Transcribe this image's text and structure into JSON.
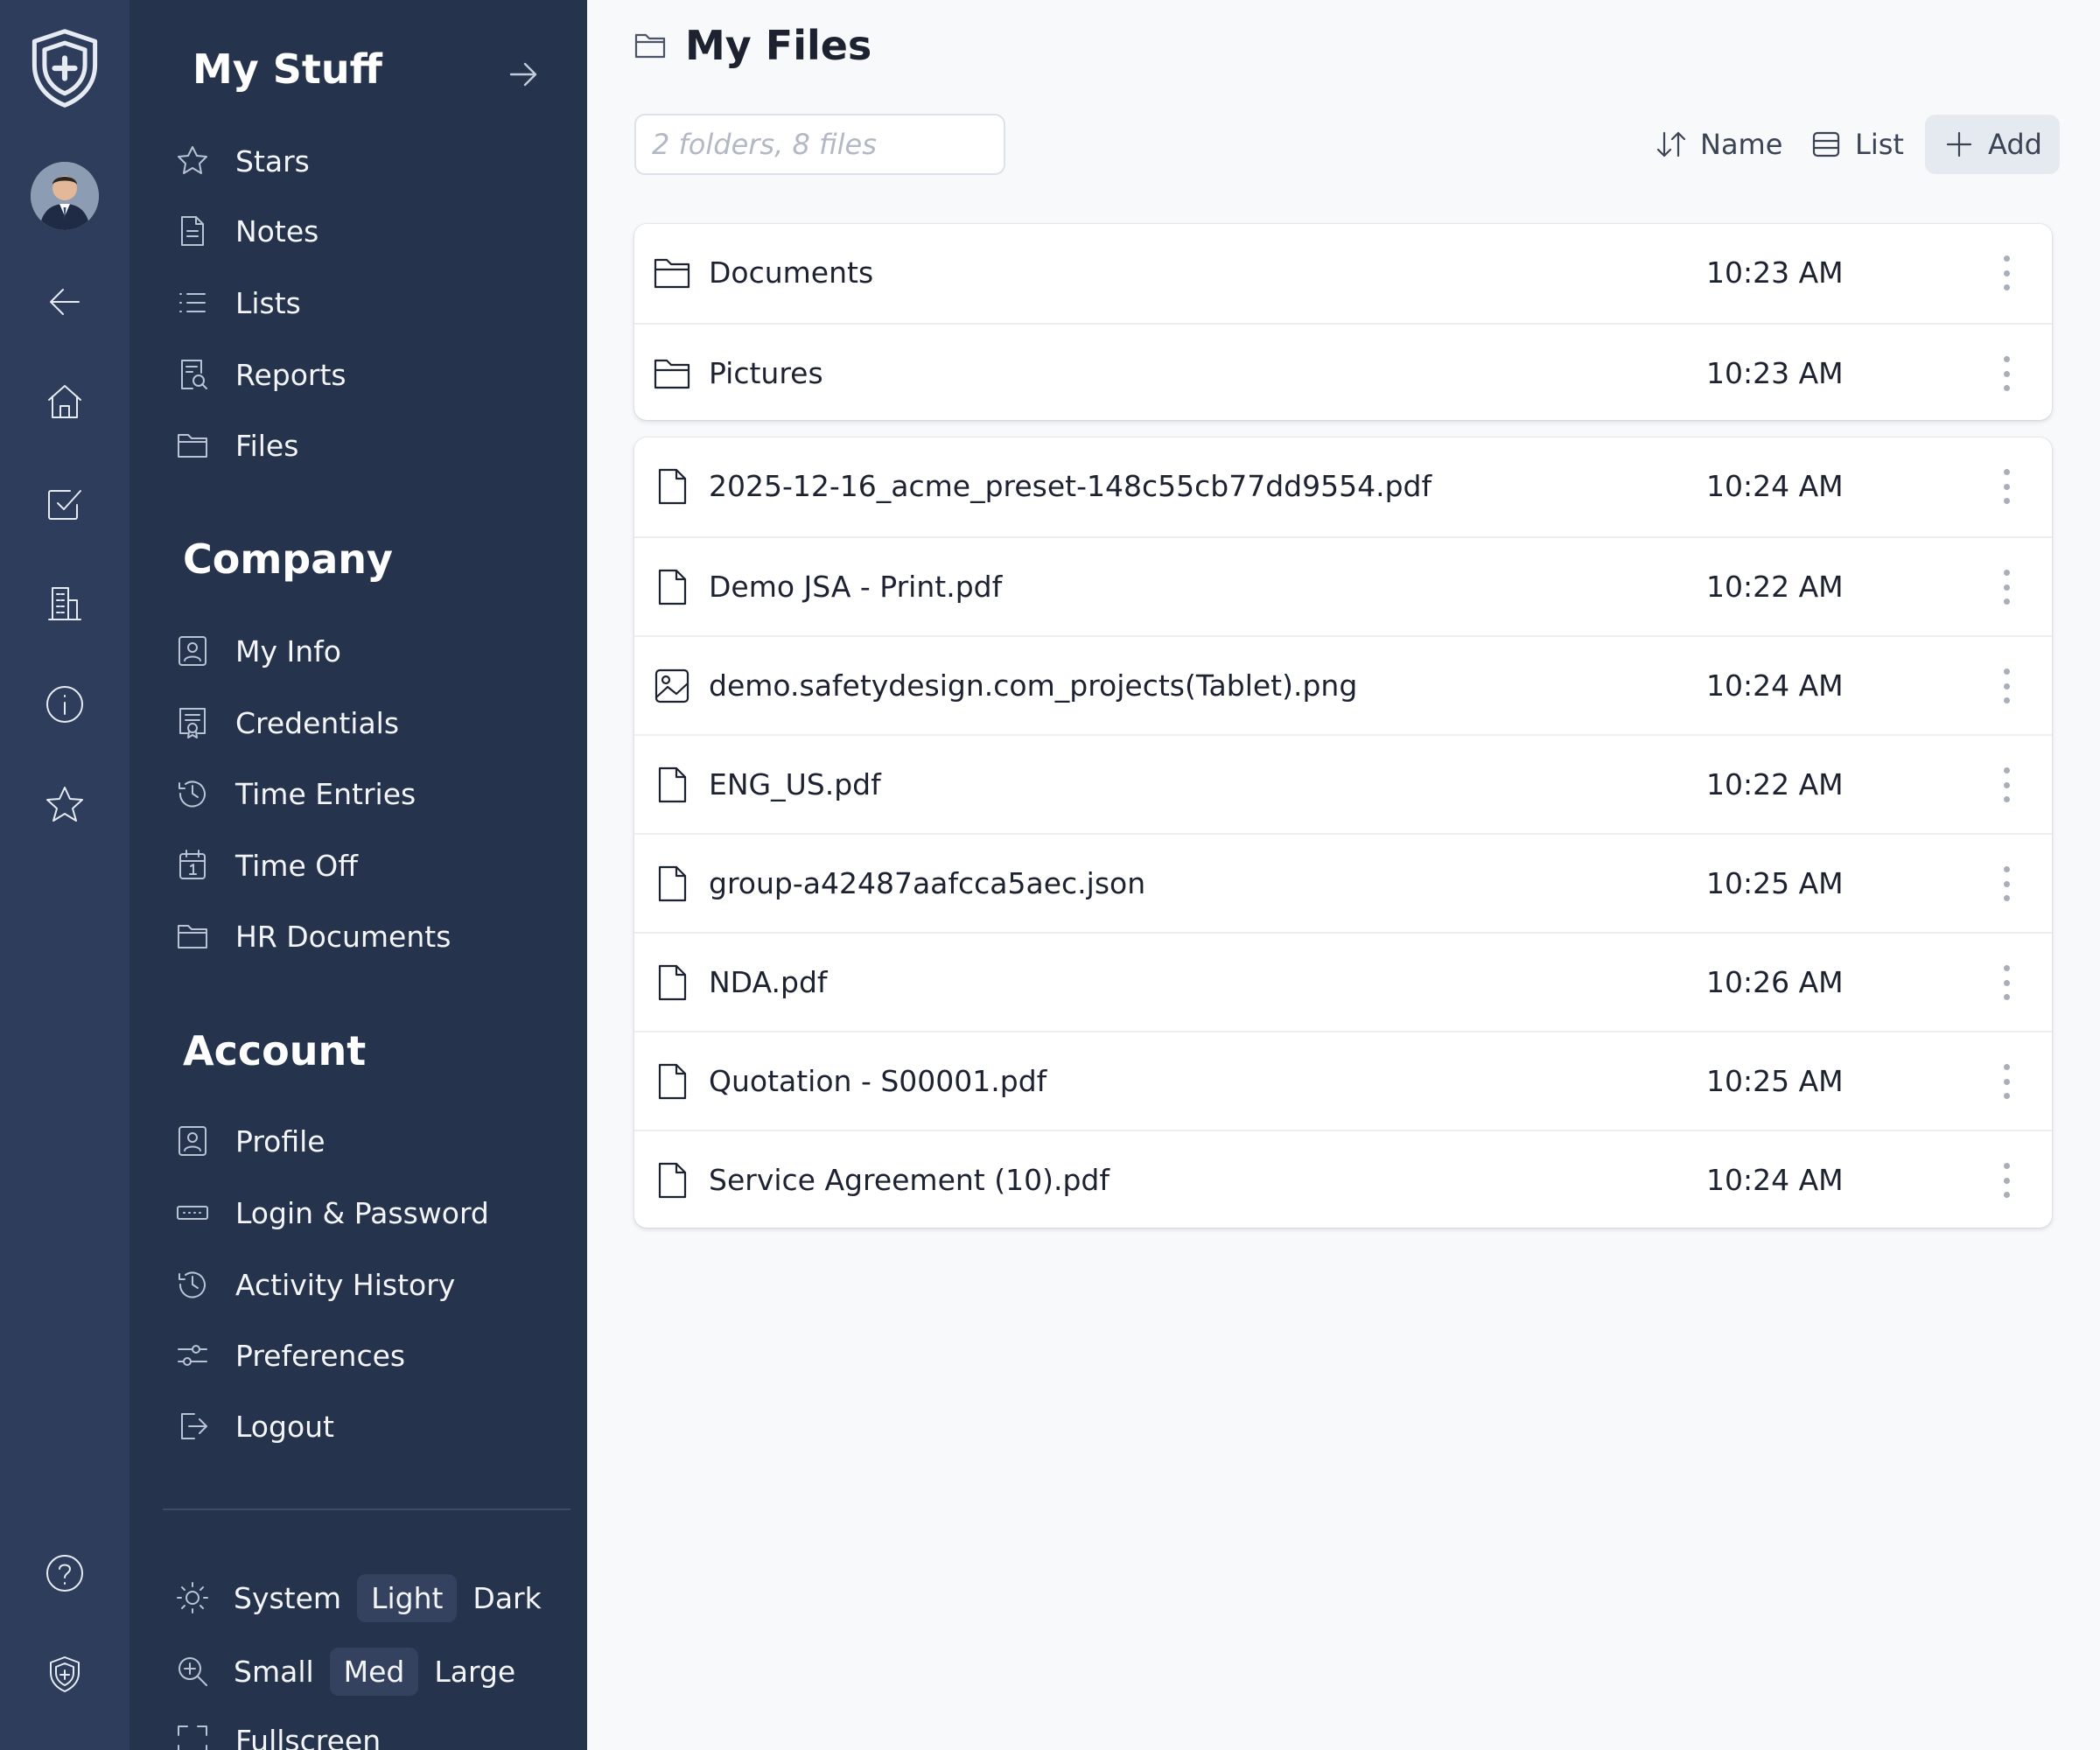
{
  "rail": {
    "items": [
      {
        "icon": "shield-logo-icon"
      },
      {
        "icon": "avatar"
      },
      {
        "icon": "arrow-left-icon"
      },
      {
        "icon": "home-icon"
      },
      {
        "icon": "checkbox-icon"
      },
      {
        "icon": "building-icon"
      },
      {
        "icon": "info-icon"
      },
      {
        "icon": "star-icon"
      },
      {
        "icon": "help-icon"
      },
      {
        "icon": "shield-small-icon"
      }
    ]
  },
  "sidebar": {
    "title": "My Stuff",
    "my_stuff": [
      {
        "label": "Stars",
        "icon": "star-icon"
      },
      {
        "label": "Notes",
        "icon": "note-icon"
      },
      {
        "label": "Lists",
        "icon": "list-icon"
      },
      {
        "label": "Reports",
        "icon": "report-icon"
      },
      {
        "label": "Files",
        "icon": "folder-icon"
      }
    ],
    "company_title": "Company",
    "company": [
      {
        "label": "My Info",
        "icon": "id-card-icon"
      },
      {
        "label": "Credentials",
        "icon": "certificate-icon"
      },
      {
        "label": "Time Entries",
        "icon": "clock-icon"
      },
      {
        "label": "Time Off",
        "icon": "calendar-icon"
      },
      {
        "label": "HR Documents",
        "icon": "folder-icon"
      }
    ],
    "account_title": "Account",
    "account": [
      {
        "label": "Profile",
        "icon": "id-card-icon"
      },
      {
        "label": "Login & Password",
        "icon": "password-icon"
      },
      {
        "label": "Activity History",
        "icon": "history-icon"
      },
      {
        "label": "Preferences",
        "icon": "sliders-icon"
      },
      {
        "label": "Logout",
        "icon": "logout-icon"
      }
    ],
    "theme": {
      "options": [
        "System",
        "Light",
        "Dark"
      ],
      "selected": "Light"
    },
    "size": {
      "options": [
        "Small",
        "Med",
        "Large"
      ],
      "selected": "Med"
    },
    "fullscreen_label": "Fullscreen"
  },
  "main": {
    "title": "My Files",
    "search_placeholder": "2 folders, 8 files",
    "sort_label": "Name",
    "view_label": "List",
    "add_label": "Add",
    "folders": [
      {
        "name": "Documents",
        "time": "10:23 AM",
        "icon": "folder-icon"
      },
      {
        "name": "Pictures",
        "time": "10:23 AM",
        "icon": "folder-icon"
      }
    ],
    "files": [
      {
        "name": "2025-12-16_acme_preset-148c55cb77dd9554.pdf",
        "time": "10:24 AM",
        "icon": "file-icon"
      },
      {
        "name": "Demo JSA - Print.pdf",
        "time": "10:22 AM",
        "icon": "file-icon"
      },
      {
        "name": "demo.safetydesign.com_projects(Tablet).png",
        "time": "10:24 AM",
        "icon": "image-icon"
      },
      {
        "name": "ENG_US.pdf",
        "time": "10:22 AM",
        "icon": "file-icon"
      },
      {
        "name": "group-a42487aafcca5aec.json",
        "time": "10:25 AM",
        "icon": "file-icon"
      },
      {
        "name": "NDA.pdf",
        "time": "10:26 AM",
        "icon": "file-icon"
      },
      {
        "name": "Quotation - S00001.pdf",
        "time": "10:25 AM",
        "icon": "file-icon"
      },
      {
        "name": "Service Agreement (10).pdf",
        "time": "10:24 AM",
        "icon": "file-icon"
      }
    ]
  }
}
